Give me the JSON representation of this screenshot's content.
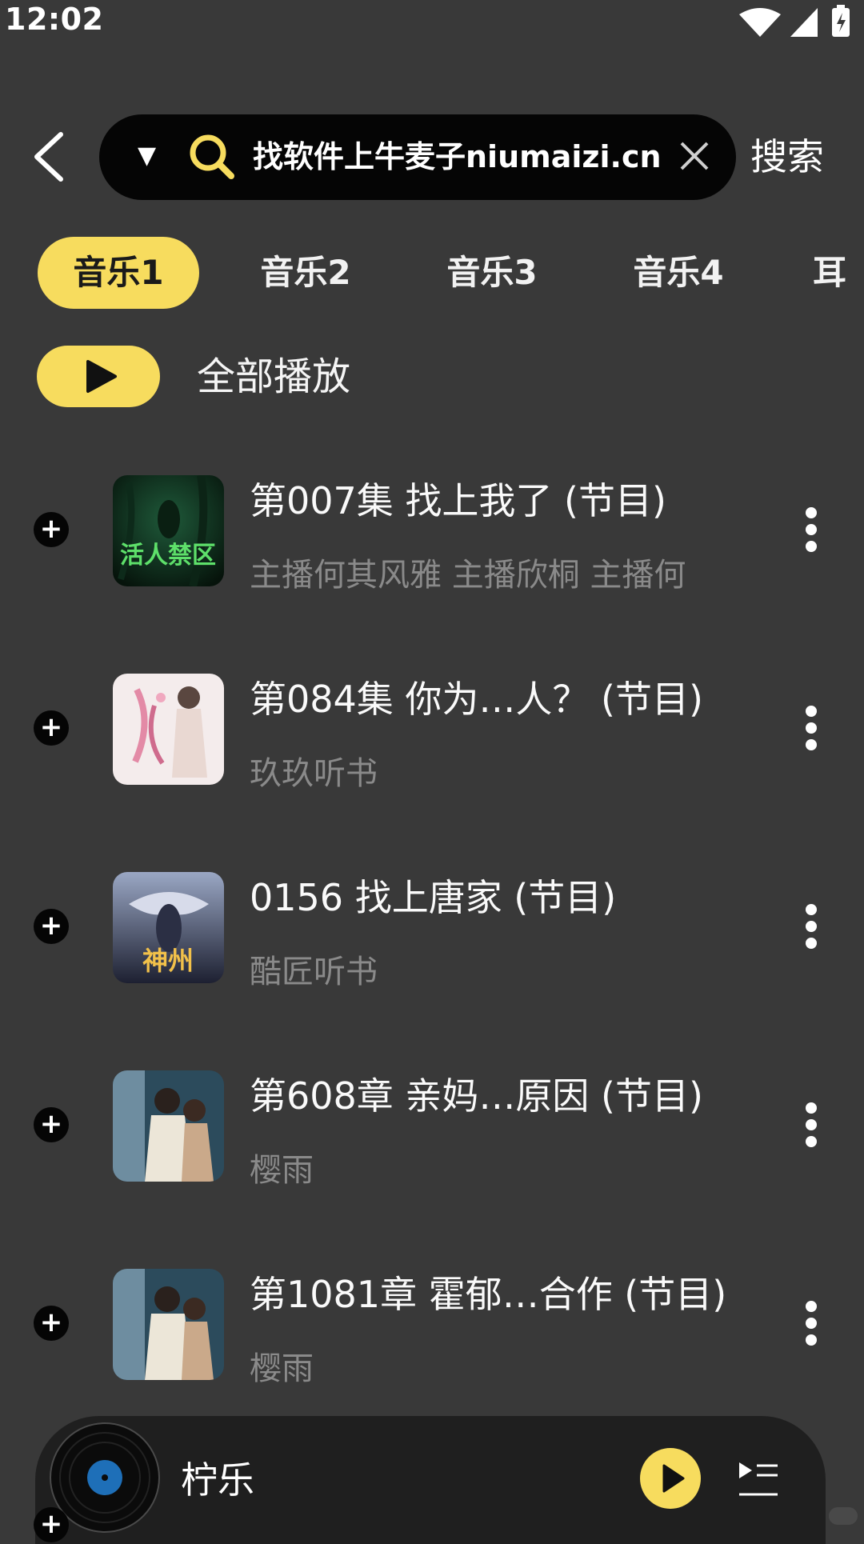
{
  "status_bar": {
    "time": "12:02"
  },
  "header": {
    "search_query": "找软件上牛麦子niumaizi.cn",
    "search_button": "搜索"
  },
  "tabs": [
    {
      "label": "音乐1",
      "active": true
    },
    {
      "label": "音乐2",
      "active": false
    },
    {
      "label": "音乐3",
      "active": false
    },
    {
      "label": "音乐4",
      "active": false
    },
    {
      "label": "耳",
      "active": false
    }
  ],
  "play_all": {
    "label": "全部播放"
  },
  "list": [
    {
      "title": "第007集 找上我了 (节目)",
      "subtitle": "主播何其风雅 主播欣桐 主播何",
      "cover": "活人禁区"
    },
    {
      "title": "第084集 你为…人？ (节目)",
      "subtitle": "玖玖听书",
      "cover": ""
    },
    {
      "title": "0156 找上唐家 (节目)",
      "subtitle": "酷匠听书",
      "cover": "神州"
    },
    {
      "title": "第608章 亲妈…原因 (节目)",
      "subtitle": "樱雨",
      "cover": ""
    },
    {
      "title": "第1081章 霍郁…合作 (节目)",
      "subtitle": "樱雨",
      "cover": ""
    }
  ],
  "player": {
    "title": "柠乐"
  },
  "colors": {
    "accent": "#f7dc5e",
    "background": "#393939",
    "search_bg": "#050505"
  }
}
